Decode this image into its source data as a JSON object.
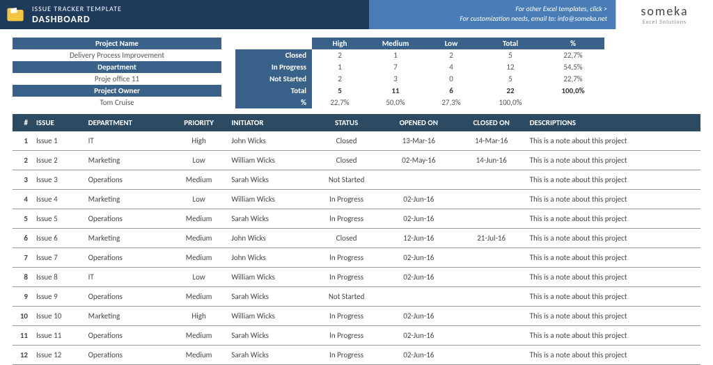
{
  "header": {
    "title1": "ISSUE TRACKER TEMPLATE",
    "title2": "DASHBOARD",
    "note1": "For other Excel templates, click >",
    "note2": "For customization needs, email to: info@someka.net",
    "logo1": "someka",
    "logo2": "Excel Solutions"
  },
  "project": {
    "name_label": "Project Name",
    "name": "Delivery Process Improvement",
    "dept_label": "Department",
    "dept": "Proje office 11",
    "owner_label": "Project Owner",
    "owner": "Tom Cruise"
  },
  "matrix": {
    "cols": [
      "High",
      "Medium",
      "Low",
      "Total",
      "%"
    ],
    "rows": [
      "Closed",
      "In Progress",
      "Not Started",
      "Total",
      "%"
    ],
    "cells": [
      [
        "2",
        "1",
        "2",
        "5",
        "22,7%"
      ],
      [
        "1",
        "7",
        "4",
        "12",
        "54,5%"
      ],
      [
        "2",
        "3",
        "0",
        "5",
        "22,7%"
      ],
      [
        "5",
        "11",
        "6",
        "22",
        "100,0%"
      ],
      [
        "22,7%",
        "50,0%",
        "27,3%",
        "100,0%",
        ""
      ]
    ]
  },
  "table": {
    "headers": [
      "#",
      "ISSUE",
      "DEPARTMENT",
      "PRIORITY",
      "INITIATOR",
      "STATUS",
      "OPENED ON",
      "CLOSED ON",
      "DESCRIPTIONS"
    ],
    "rows": [
      [
        "1",
        "Issue 1",
        "IT",
        "High",
        "John Wicks",
        "Closed",
        "13-Mar-16",
        "14-Mar-16",
        "This is a note about this project"
      ],
      [
        "2",
        "Issue 2",
        "Marketing",
        "Low",
        "William Wicks",
        "Closed",
        "02-May-16",
        "14-Jun-16",
        "This is a note about this project"
      ],
      [
        "3",
        "Issue 3",
        "Operations",
        "Medium",
        "Sarah  Wicks",
        "Not Started",
        "",
        "",
        "This is a note about this project"
      ],
      [
        "4",
        "Issue 4",
        "Marketing",
        "Low",
        "William Wicks",
        "In Progress",
        "02-Jun-16",
        "",
        "This is a note about this project"
      ],
      [
        "5",
        "Issue 5",
        "Operations",
        "Medium",
        "Sarah  Wicks",
        "In Progress",
        "02-Jun-16",
        "",
        "This is a note about this project"
      ],
      [
        "6",
        "Issue 6",
        "Marketing",
        "Medium",
        "John Wicks",
        "Closed",
        "12-Jun-16",
        "21-Jul-16",
        "This is a note about this project"
      ],
      [
        "7",
        "Issue 7",
        "Operations",
        "Medium",
        "John Wicks",
        "In Progress",
        "02-Jun-16",
        "",
        "This is a note about this project"
      ],
      [
        "8",
        "Issue 8",
        "IT",
        "Low",
        "William Wicks",
        "In Progress",
        "02-Jun-16",
        "",
        "This is a note about this project"
      ],
      [
        "9",
        "Issue 9",
        "Operations",
        "Medium",
        "Sarah  Wicks",
        "Not Started",
        "",
        "",
        "This is a note about this project"
      ],
      [
        "10",
        "Issue 10",
        "Marketing",
        "High",
        "William Wicks",
        "In Progress",
        "02-Jun-16",
        "",
        "This is a note about this project"
      ],
      [
        "11",
        "Issue 11",
        "Operations",
        "Medium",
        "Sarah  Wicks",
        "In Progress",
        "02-Jun-16",
        "",
        "This is a note about this project"
      ],
      [
        "12",
        "Issue 12",
        "Operations",
        "Medium",
        "Sarah  Wicks",
        "In Progress",
        "02-Jun-16",
        "",
        "This is a note about this project"
      ]
    ]
  }
}
